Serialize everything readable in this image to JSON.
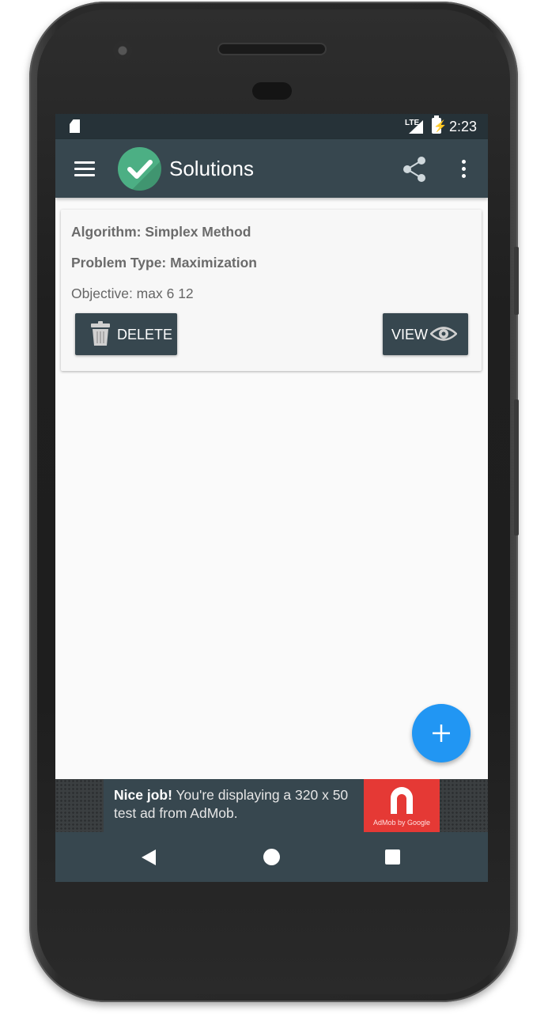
{
  "status_bar": {
    "network": "LTE",
    "time": "2:23"
  },
  "app_bar": {
    "title": "Solutions",
    "logo_color": "#4caf84",
    "background_color": "#37474f"
  },
  "solution_card": {
    "algorithm_line": "Algorithm: Simplex Method",
    "problem_type_line": "Problem Type: Maximization",
    "objective_line": "Objective: max 6 12",
    "delete_label": "DELETE",
    "view_label": "VIEW"
  },
  "fab": {
    "icon": "plus-icon",
    "color": "#2196f3"
  },
  "ad_banner": {
    "headline": "Nice job!",
    "body": " You're displaying a 320 x 50 test ad from AdMob.",
    "logo_text": "AdMob by Google",
    "logo_color": "#e53935"
  },
  "nav_bar": {
    "icons": [
      "back-icon",
      "home-icon",
      "recents-icon"
    ]
  }
}
